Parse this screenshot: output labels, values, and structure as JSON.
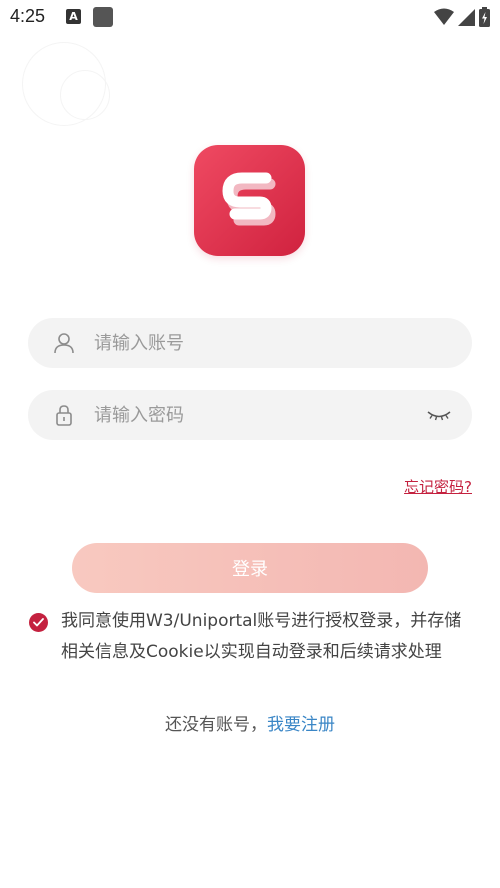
{
  "status_bar": {
    "time": "4:25",
    "notification_letter": "A"
  },
  "icons": {
    "logo": "brand-s-logo",
    "account": "user-icon",
    "password": "lock-icon",
    "toggle": "eye-closed-icon",
    "agree": "check-circle-icon"
  },
  "colors": {
    "brand": "#d42a46",
    "button": "#f5c0b9",
    "link": "#3a86c6"
  },
  "login_form": {
    "account_placeholder": "请输入账号",
    "password_placeholder": "请输入密码",
    "forgot_label": "忘记密码?",
    "login_label": "登录"
  },
  "agreement": {
    "text": "我同意使用W3/Uniportal账号进行授权登录，并存储相关信息及Cookie以实现自动登录和后续请求处理",
    "checked": true
  },
  "register": {
    "prompt": "还没有账号，",
    "link": "我要注册"
  }
}
